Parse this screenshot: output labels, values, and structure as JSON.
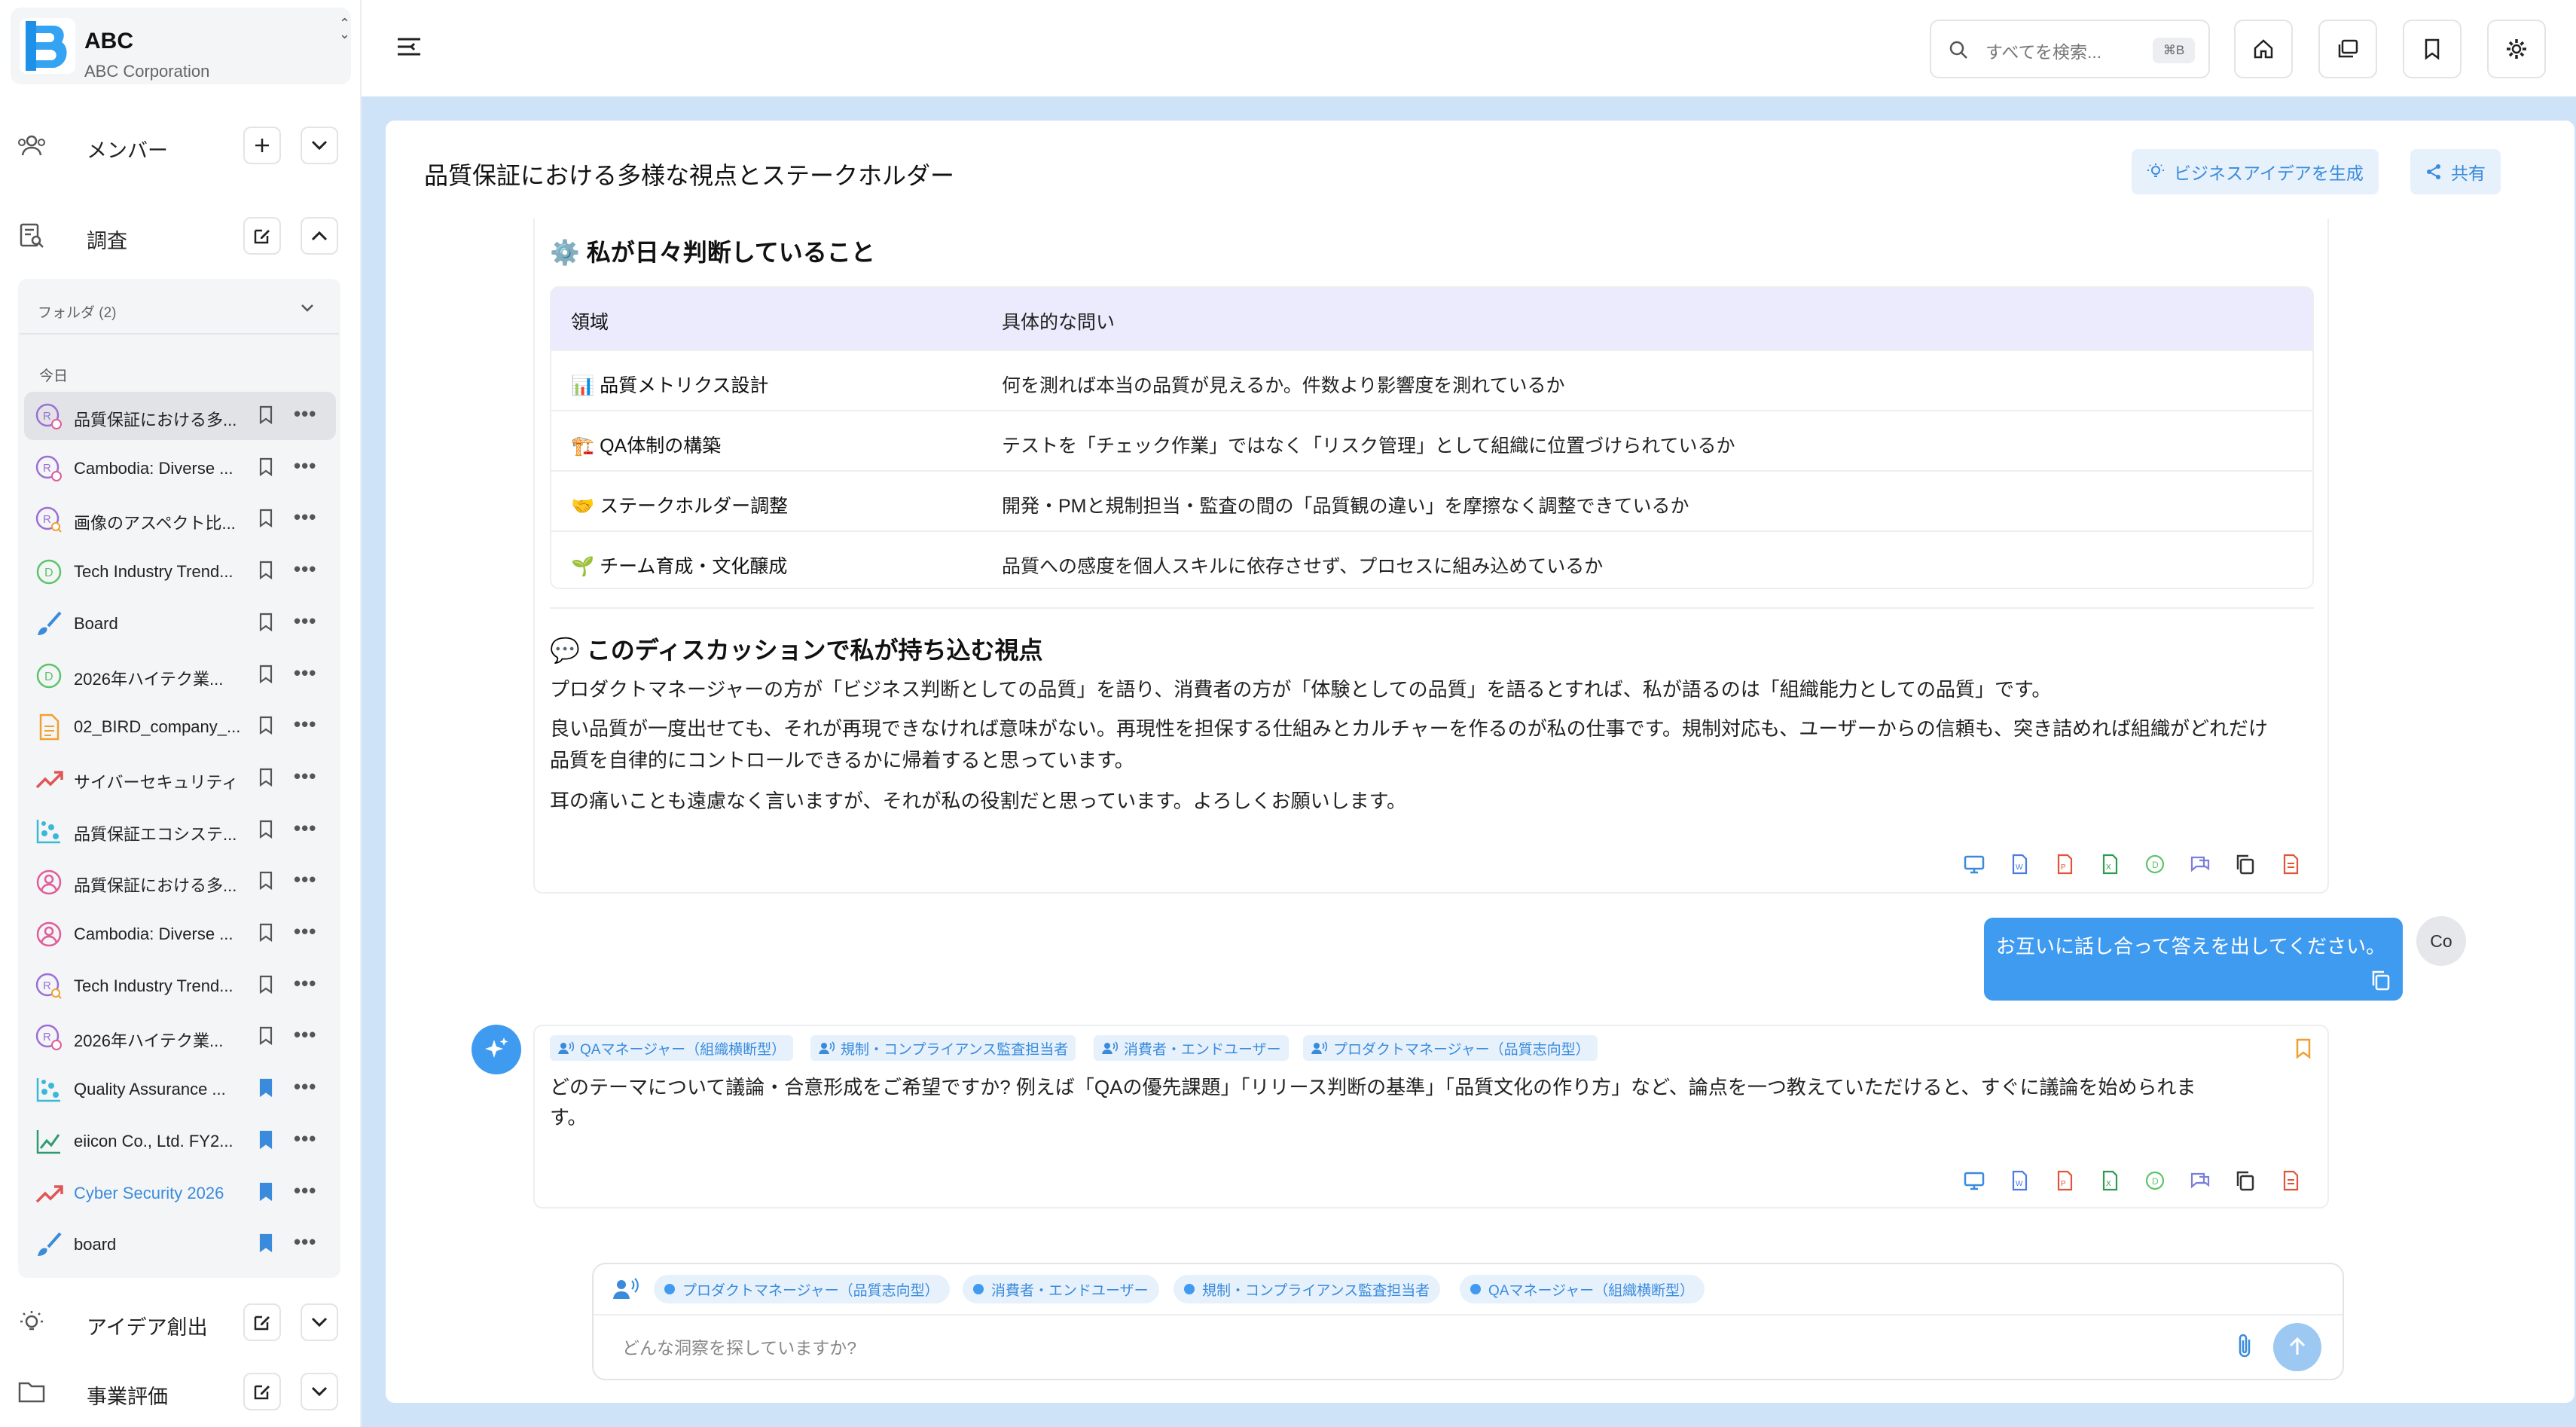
{
  "brand": {
    "name": "ABC",
    "corp": "ABC Corporation",
    "color": "#1e90e8"
  },
  "sidebar": {
    "members_label": "メンバー",
    "research_label": "調査",
    "folder_label": "フォルダ (2)",
    "today_label": "今日",
    "items": [
      {
        "label": "品質保証における多...",
        "icon": "research-person-icon",
        "bookmarked": false,
        "active": true
      },
      {
        "label": "Cambodia: Diverse ...",
        "icon": "research-person-icon",
        "bookmarked": false
      },
      {
        "label": "画像のアスペクト比...",
        "icon": "research-search-icon",
        "bookmarked": false
      },
      {
        "label": "Tech Industry Trend...",
        "icon": "d-circle-icon",
        "bookmarked": false
      },
      {
        "label": "Board",
        "icon": "brush-icon",
        "bookmarked": false
      },
      {
        "label": "2026年ハイテク業...",
        "icon": "d-circle-icon",
        "bookmarked": false
      },
      {
        "label": "02_BIRD_company_...",
        "icon": "document-icon",
        "bookmarked": false
      },
      {
        "label": "サイバーセキュリティ",
        "icon": "trend-up-icon",
        "bookmarked": false
      },
      {
        "label": "品質保証エコシステ...",
        "icon": "scatter-icon",
        "bookmarked": false
      },
      {
        "label": "品質保証における多...",
        "icon": "person-circle-icon",
        "bookmarked": false
      },
      {
        "label": "Cambodia: Diverse ...",
        "icon": "person-circle-icon",
        "bookmarked": false
      },
      {
        "label": "Tech Industry Trend...",
        "icon": "research-search-icon",
        "bookmarked": false
      },
      {
        "label": "2026年ハイテク業...",
        "icon": "research-person-icon",
        "bookmarked": false
      },
      {
        "label": "Quality Assurance ...",
        "icon": "scatter-icon",
        "bookmarked": true
      },
      {
        "label": "eiicon Co., Ltd. FY2...",
        "icon": "line-chart-icon",
        "bookmarked": true
      },
      {
        "label": "Cyber Security 2026",
        "icon": "trend-up-icon",
        "bookmarked": true,
        "highlight": true
      },
      {
        "label": "board",
        "icon": "brush-icon",
        "bookmarked": true
      }
    ],
    "ideas_label": "アイデア創出",
    "eval_label": "事業評価"
  },
  "topbar": {
    "search_placeholder": "すべてを検索...",
    "search_shortcut": "⌘B"
  },
  "page": {
    "title": "品質保証における多様な視点とステークホルダー",
    "generate_button": "ビジネスアイデアを生成",
    "share_button": "共有"
  },
  "message1": {
    "heading1": "⚙️ 私が日々判断していること",
    "table": {
      "headers": [
        "領域",
        "具体的な問い"
      ],
      "rows": [
        [
          "📊 品質メトリクス設計",
          "何を測れば本当の品質が見えるか。件数より影響度を測れているか"
        ],
        [
          "🏗️ QA体制の構築",
          "テストを「チェック作業」ではなく「リスク管理」として組織に位置づけられているか"
        ],
        [
          "🤝 ステークホルダー調整",
          "開発・PMと規制担当・監査の間の「品質観の違い」を摩擦なく調整できているか"
        ],
        [
          "🌱 チーム育成・文化醸成",
          "品質への感度を個人スキルに依存させず、プロセスに組み込めているか"
        ]
      ]
    },
    "heading2": "💬 このディスカッションで私が持ち込む視点",
    "p1": "プロダクトマネージャーの方が「ビジネス判断としての品質」を語り、消費者の方が「体験としての品質」を語るとすれば、私が語るのは「組織能力としての品質」です。",
    "p2a": "良い品質が一度出せても、それが再現できなければ意味がない。再現性を担保する仕組みとカルチャーを作るのが私の仕事です。規制対応も、ユーザーからの信頼も、突き詰めれば組織がどれだけ",
    "p2b": "品質を自律的にコントロールできるかに帰着すると思っています。",
    "p3": "耳の痛いことも遠慮なく言いますが、それが私の役割だと思っています。よろしくお願いします。"
  },
  "user_message": {
    "text": "お互いに話し合って答えを出してください。",
    "avatar": "Co"
  },
  "message2": {
    "tags": [
      "QAマネージャー（組織横断型）",
      "規制・コンプライアンス監査担当者",
      "消費者・エンドユーザー",
      "プロダクトマネージャー（品質志向型）"
    ],
    "line1": "どのテーマについて議論・合意形成をご希望ですか? 例えば「QAの優先課題」「リリース判断の基準」「品質文化の作り方」など、論点を一つ教えていただけると、すぐに議論を始められま",
    "line2": "す。"
  },
  "composer": {
    "tags": [
      "プロダクトマネージャー（品質志向型）",
      "消費者・エンドユーザー",
      "規制・コンプライアンス監査担当者",
      "QAマネージャー（組織横断型）"
    ],
    "placeholder": "どんな洞察を探していますか?"
  },
  "colors": {
    "accent": "#3f9bf0",
    "main_bg": "#cfe3f8",
    "table_head": "#ebebfd"
  }
}
